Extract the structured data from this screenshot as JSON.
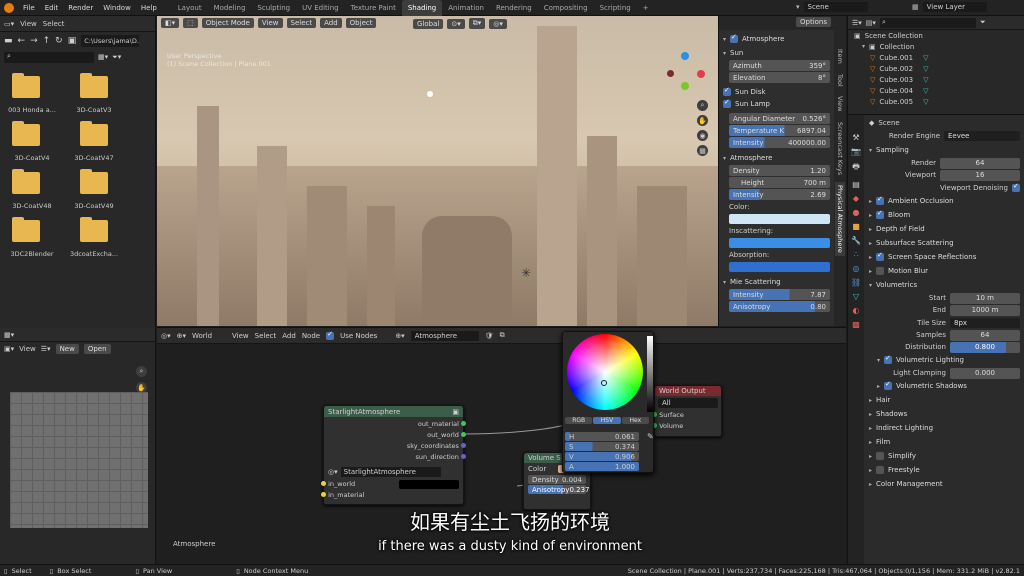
{
  "topbar": {
    "menus": [
      "File",
      "Edit",
      "Render",
      "Window",
      "Help"
    ],
    "workspaces": [
      "Layout",
      "Modeling",
      "Sculpting",
      "UV Editing",
      "Texture Paint",
      "Shading",
      "Animation",
      "Rendering",
      "Compositing",
      "Scripting"
    ],
    "active_workspace": "Shading",
    "scene_label": "Scene",
    "view_layer_label": "View Layer"
  },
  "file_browser": {
    "header": {
      "view": "View",
      "select": "Select"
    },
    "path": "C:\\Users\\jama\\D...",
    "items": [
      "003 Honda a...",
      "3D-CoatV3",
      "3D-CoatV4",
      "3D-CoatV47",
      "3D-CoatV48",
      "3D-CoatV49",
      "3DC2Blender",
      "3dcoatExcha..."
    ]
  },
  "image_editor": {
    "view": "View",
    "new": "New",
    "open": "Open"
  },
  "viewport": {
    "mode": "Object Mode",
    "menus": [
      "View",
      "Select",
      "Add",
      "Object"
    ],
    "orientation": "Global",
    "options": "Options",
    "overlay_line1": "User Perspective",
    "overlay_line2": "(1) Scene Collection | Plane.001"
  },
  "atmosphere_panel": {
    "title": "Atmosphere",
    "sun_section": "Sun",
    "azimuth_label": "Azimuth",
    "azimuth": "359°",
    "elevation_label": "Elevation",
    "elevation": "8°",
    "sun_disk": "Sun Disk",
    "sun_lamp": "Sun Lamp",
    "angular_label": "Angular Diameter",
    "angular": "0.526°",
    "temperature_label": "Temperature K",
    "temperature": "6897.04",
    "intensity_label": "Intensity",
    "intensity": "400000.00",
    "atmo_section": "Atmosphere",
    "density_label": "Density",
    "density": "1.20",
    "height_label": "Height",
    "height": "700 m",
    "atmo_intensity_label": "Intensity",
    "atmo_intensity": "2.69",
    "color_label": "Color:",
    "inscattering_label": "Inscattering:",
    "absorption_label": "Absorption:",
    "mie_section": "Mie Scattering",
    "mie_intensity_label": "Intensity",
    "mie_intensity": "7.87",
    "anisotropy_label": "Anisotropy",
    "anisotropy": "0.80",
    "colors": {
      "color": "#cfe6f5",
      "inscattering": "#3b8ee6",
      "absorption": "#2f6fd0"
    }
  },
  "side_tabs": [
    "Item",
    "Tool",
    "View",
    "Screencast Keys",
    "Physical Atmosphere"
  ],
  "outliner": {
    "root": "Scene Collection",
    "collection": "Collection",
    "items": [
      "Cube.001",
      "Cube.002",
      "Cube.003",
      "Cube.004",
      "Cube.005"
    ]
  },
  "properties": {
    "scene": "Scene",
    "render_engine_label": "Render Engine",
    "render_engine": "Eevee",
    "sampling": "Sampling",
    "render_label": "Render",
    "render_value": "64",
    "viewport_label": "Viewport",
    "viewport_value": "16",
    "viewport_denoising": "Viewport Denoising",
    "sections": [
      {
        "label": "Ambient Occlusion",
        "check": true
      },
      {
        "label": "Bloom",
        "check": true
      },
      {
        "label": "Depth of Field",
        "check": null
      },
      {
        "label": "Subsurface Scattering",
        "check": null
      },
      {
        "label": "Screen Space Reflections",
        "check": true
      },
      {
        "label": "Motion Blur",
        "check": false
      }
    ],
    "volumetrics": "Volumetrics",
    "start_label": "Start",
    "start": "10 m",
    "end_label": "End",
    "end": "1000 m",
    "tile_label": "Tile Size",
    "tile": "8px",
    "samples_label": "Samples",
    "samples": "64",
    "distribution_label": "Distribution",
    "distribution": "0.800",
    "volumetric_lighting": "Volumetric Lighting",
    "light_clamping_label": "Light Clamping",
    "light_clamping": "0.000",
    "volumetric_shadows": "Volumetric Shadows",
    "more_sections": [
      {
        "label": "Hair",
        "check": null
      },
      {
        "label": "Shadows",
        "check": null
      },
      {
        "label": "Indirect Lighting",
        "check": null
      },
      {
        "label": "Film",
        "check": null
      },
      {
        "label": "Simplify",
        "check": false
      },
      {
        "label": "Freestyle",
        "check": false
      },
      {
        "label": "Color Management",
        "check": null
      }
    ]
  },
  "node_editor": {
    "world_label": "World",
    "menus": [
      "View",
      "Select",
      "Add",
      "Node"
    ],
    "use_nodes": "Use Nodes",
    "world_name": "Atmosphere",
    "bottom_label": "Atmosphere",
    "starlight": {
      "title": "StarlightAtmosphere",
      "outputs": [
        "out_material",
        "out_world",
        "sky_coordinates",
        "sun_direction"
      ],
      "group": "StarlightAtmosphere",
      "inputs": [
        "in_world",
        "in_material"
      ]
    },
    "world_output": {
      "title": "World Output",
      "target": "All",
      "sockets": [
        "Surface",
        "Volume"
      ]
    },
    "volume": {
      "title": "Volume S",
      "color_label": "Color",
      "density_label": "Density",
      "density": "0.004",
      "anisotropy_label": "Anisotropy",
      "anisotropy": "0.237",
      "swatch": "#f4c9a7"
    },
    "picker": {
      "modes": [
        "RGB",
        "HSV",
        "Hex"
      ],
      "active": "HSV",
      "h_label": "H",
      "h": "0.061",
      "s_label": "S",
      "s": "0.374",
      "v_label": "V",
      "v": "0.906",
      "a_label": "A",
      "a": "1.000"
    }
  },
  "subtitles": {
    "chinese": "如果有尘土飞扬的环境",
    "english": "if there was a dusty kind of environment"
  },
  "statusbar": {
    "select": "Select",
    "box_select": "Box Select",
    "pan_view": "Pan View",
    "context": "Node Context Menu",
    "stats": "Scene Collection | Plane.001 | Verts:237,734 | Faces:225,168 | Tris:467,064 | Objects:0/1,156 | Mem: 331.2 MiB | v2.82.1"
  }
}
